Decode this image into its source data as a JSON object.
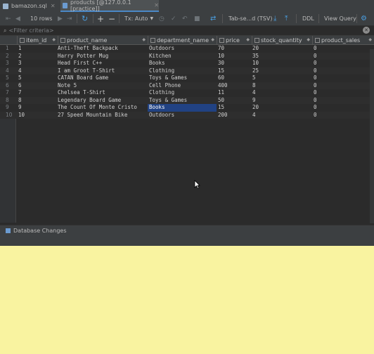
{
  "tabs": [
    {
      "label": "bamazon.sql",
      "active": false
    },
    {
      "label": "products [@127.0.0.1 [practice]]",
      "active": true
    }
  ],
  "toolbar": {
    "rows": "10 rows",
    "tx": "Tx: Auto",
    "format": "Tab-se...d (TSV)",
    "ddl": "DDL",
    "view_query": "View Query"
  },
  "filter": {
    "placeholder": "<Filter criteria>"
  },
  "columns": [
    "item_id",
    "product_name",
    "department_name",
    "price",
    "stock_quantity",
    "product_sales"
  ],
  "rows": [
    {
      "n": "1",
      "item_id": "1",
      "product_name": "Anti-Theft Backpack",
      "department_name": "Outdoors",
      "price": "70",
      "stock_quantity": "20",
      "product_sales": "0"
    },
    {
      "n": "2",
      "item_id": "2",
      "product_name": "Harry Potter Mug",
      "department_name": "Kitchen",
      "price": "10",
      "stock_quantity": "35",
      "product_sales": "0"
    },
    {
      "n": "3",
      "item_id": "3",
      "product_name": "Head First C++",
      "department_name": "Books",
      "price": "30",
      "stock_quantity": "10",
      "product_sales": "0"
    },
    {
      "n": "4",
      "item_id": "4",
      "product_name": "I am Groot T-Shirt",
      "department_name": "Clothing",
      "price": "15",
      "stock_quantity": "25",
      "product_sales": "0"
    },
    {
      "n": "5",
      "item_id": "5",
      "product_name": "CATAN Board Game",
      "department_name": "Toys & Games",
      "price": "60",
      "stock_quantity": "5",
      "product_sales": "0"
    },
    {
      "n": "6",
      "item_id": "6",
      "product_name": "Note 5",
      "department_name": "Cell Phone",
      "price": "400",
      "stock_quantity": "8",
      "product_sales": "0"
    },
    {
      "n": "7",
      "item_id": "7",
      "product_name": "Chelsea T-Shirt",
      "department_name": "Clothing",
      "price": "11",
      "stock_quantity": "4",
      "product_sales": "0"
    },
    {
      "n": "8",
      "item_id": "8",
      "product_name": "Legendary Board Game",
      "department_name": "Toys & Games",
      "price": "50",
      "stock_quantity": "9",
      "product_sales": "0"
    },
    {
      "n": "9",
      "item_id": "9",
      "product_name": "The Count Of Monte Cristo",
      "department_name": "Books",
      "price": "15",
      "stock_quantity": "20",
      "product_sales": "0"
    },
    {
      "n": "10",
      "item_id": "10",
      "product_name": "27 Speed Mountain Bike",
      "department_name": "Outdoors",
      "price": "200",
      "stock_quantity": "4",
      "product_sales": "0"
    }
  ],
  "selected_cell": {
    "row": 9,
    "column": "department_name"
  },
  "bottom": {
    "label": "Database Changes"
  },
  "colors": {
    "accent": "#4a88c7",
    "selection": "#214283",
    "background": "#2b2b2b",
    "desktop": "#f9f3a0"
  }
}
